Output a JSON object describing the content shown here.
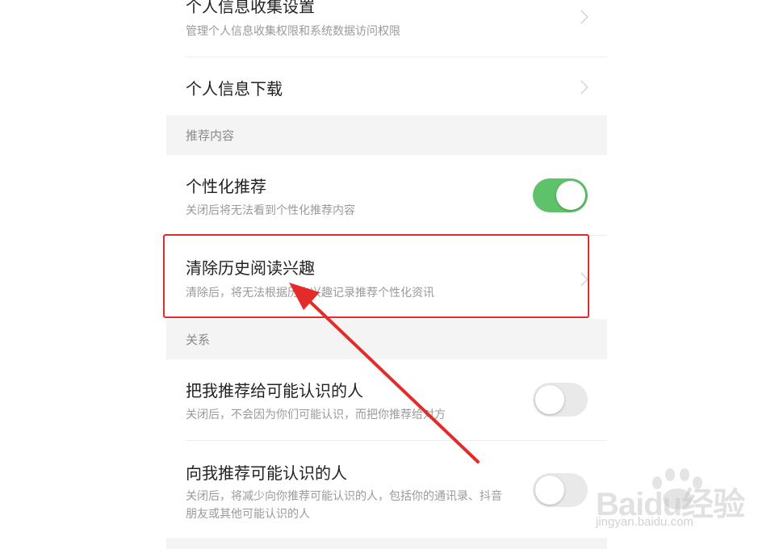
{
  "rows": {
    "personal_info_collection": {
      "title": "个人信息收集设置",
      "subtitle": "管理个人信息收集权限和系统数据访问权限"
    },
    "personal_info_download": {
      "title": "个人信息下载"
    },
    "personalized_recommend": {
      "title": "个性化推荐",
      "subtitle": "关闭后将无法看到个性化推荐内容",
      "enabled": true
    },
    "clear_history_interest": {
      "title": "清除历史阅读兴趣",
      "subtitle": "清除后，将无法根据历史兴趣记录推荐个性化资讯"
    },
    "recommend_me_to_others": {
      "title": "把我推荐给可能认识的人",
      "subtitle": "关闭后，不会因为你们可能认识，而把你推荐给对方",
      "enabled": false
    },
    "recommend_to_me": {
      "title": "向我推荐可能认识的人",
      "subtitle": "关闭后，将减少向你推荐可能认识的人，包括你的通讯录、抖音朋友或其他可能认识的人",
      "enabled": false
    }
  },
  "sections": {
    "recommend_content": "推荐内容",
    "relations": "关系"
  },
  "watermark": {
    "brand": "Baidu经验",
    "url": "jingyan.baidu.com"
  },
  "colors": {
    "toggle_on": "#5ec26a",
    "toggle_off": "#e9e9e9",
    "highlight": "#e52a2a",
    "arrow": "#e52a2a"
  }
}
